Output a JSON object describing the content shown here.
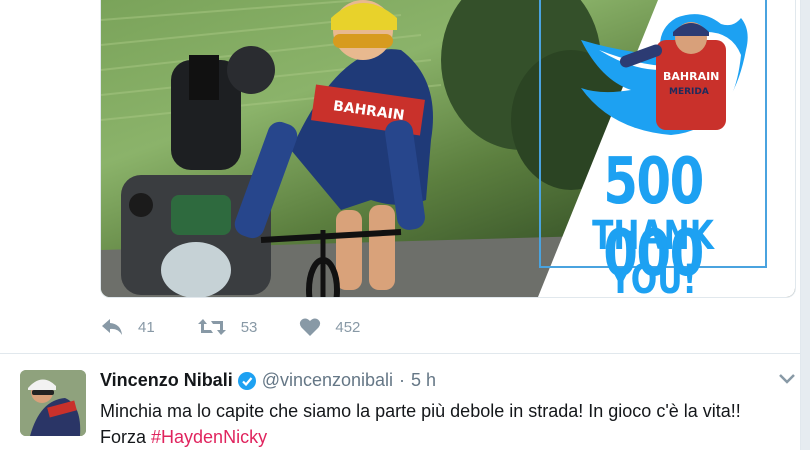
{
  "media": {
    "promo_number": "500 000",
    "promo_thanks": "THANK YOU!",
    "rider_jersey_text": "BAHRAIN",
    "promo_jersey_text": "BAHRAIN",
    "promo_jersey_sub": "MERIDA"
  },
  "actions": {
    "reply_count": "41",
    "retweet_count": "53",
    "like_count": "452"
  },
  "tweet": {
    "name": "Vincenzo Nibali",
    "handle": "@vincenzonibali",
    "separator": "·",
    "time": "5 h",
    "text_line1": "Minchia ma lo capite che siamo la parte più debole in strada! In gioco c'è la vita!!",
    "text_prefix": "Forza ",
    "hashtag": "#HaydenNicky"
  },
  "colors": {
    "accent": "#1da1f2",
    "hashtag": "#e0245e",
    "muted": "#657786",
    "verified": "#1da1f2"
  },
  "icons": [
    "reply-icon",
    "retweet-icon",
    "heart-icon",
    "verified-badge-icon",
    "caret-down-icon",
    "twitter-bird-icon"
  ]
}
